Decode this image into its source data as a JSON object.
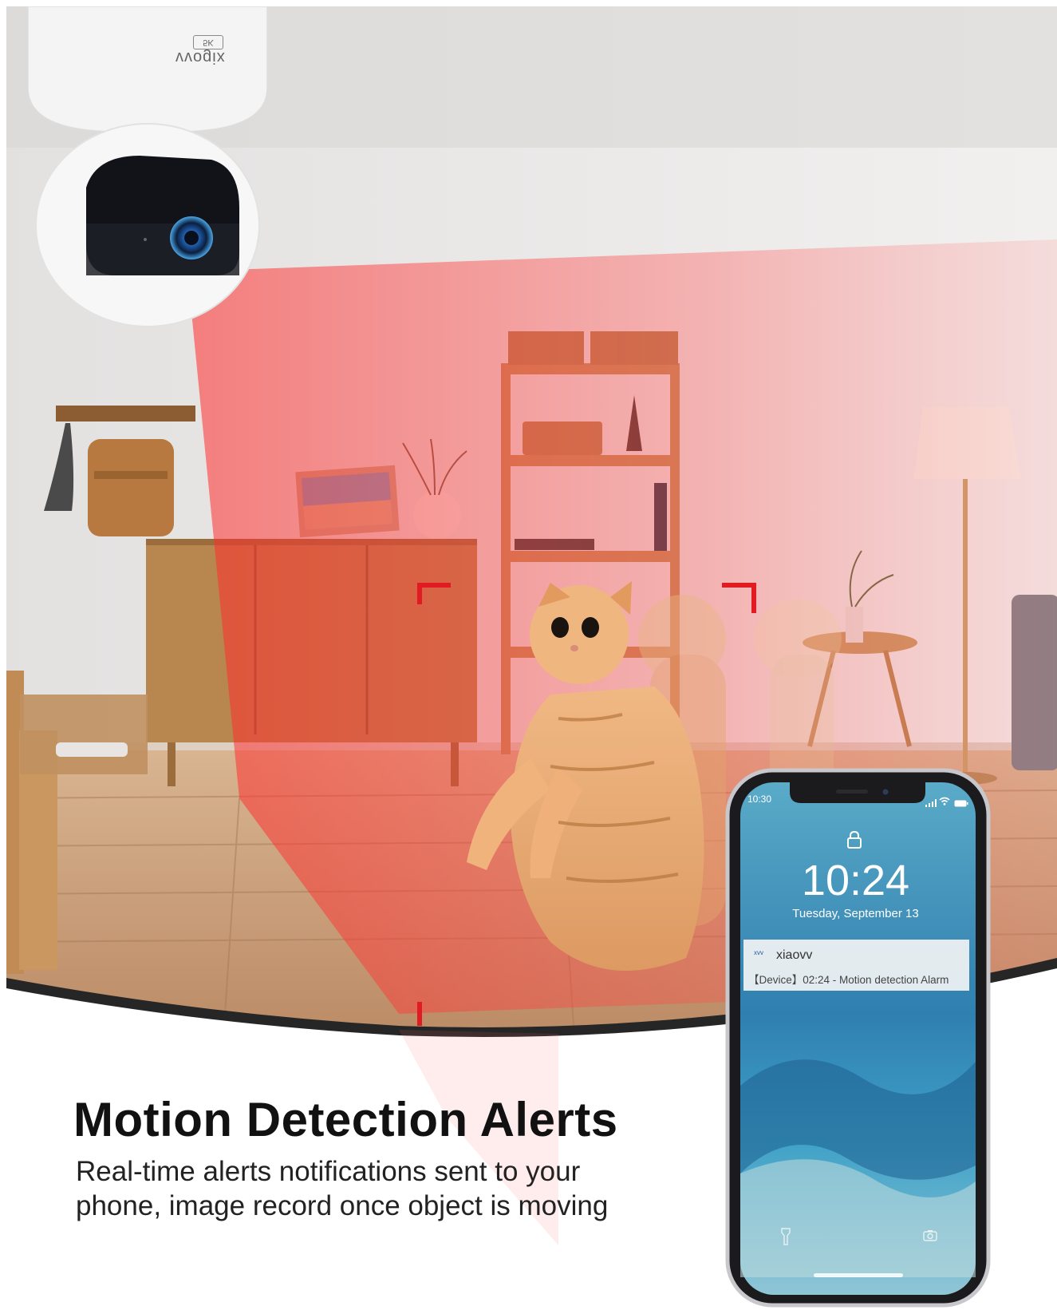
{
  "camera": {
    "brand": "vvogix",
    "model_badge": "5K"
  },
  "headline": "Motion Detection Alerts",
  "description": "Real-time alerts notifications sent to your phone, image record once object is moving",
  "phone": {
    "status_time": "10:30",
    "lock_time": "10:24",
    "lock_date": "Tuesday, September 13",
    "notification": {
      "app_badge": "xvv",
      "app_name": "xiaovv",
      "message": "【Device】02:24 - Motion detection Alarm"
    }
  },
  "colors": {
    "motion_red": "#e21b22",
    "detection_overlay": "#ff3b3b",
    "wall": "#e9e6e4",
    "floor": "#c9a07a",
    "cabinet": "#b98855",
    "cat": "#e8a872",
    "phone_screen": "#3f8fb3"
  },
  "icons": [
    "lock-icon",
    "signal-icon",
    "wifi-icon",
    "battery-icon",
    "flashlight-icon",
    "camera-icon"
  ]
}
